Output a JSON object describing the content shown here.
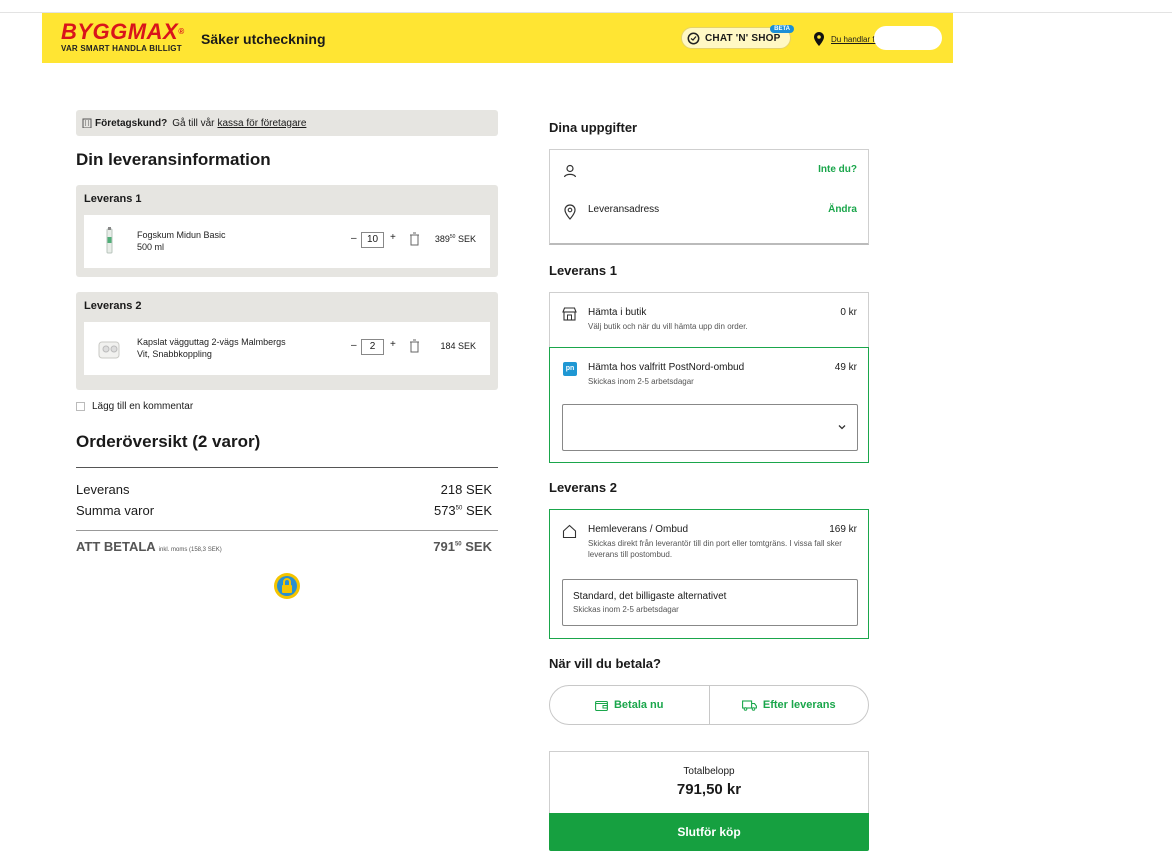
{
  "header": {
    "logo_text": "BYGGMAX",
    "logo_tagline": "VAR SMART HANDLA BILLIGT",
    "title": "Säker utcheckning",
    "chat_label": "CHAT 'N' SHOP",
    "chat_badge": "BETA",
    "store_link": "Du handlar frå"
  },
  "business": {
    "label": "Företagskund?",
    "text": "Gå till vår",
    "link": "kassa för företagare"
  },
  "delivery_info": {
    "title": "Din leveransinformation",
    "deliveries": [
      {
        "title": "Leverans 1",
        "product_name": "Fogskum Midun Basic",
        "product_detail": "500 ml",
        "quantity": "10",
        "price_main": "389",
        "price_dec": "50",
        "price_currency": "SEK"
      },
      {
        "title": "Leverans 2",
        "product_name": "Kapslat vägguttag 2-vägs Malmbergs",
        "product_detail": "Vit, Snabbkoppling",
        "quantity": "2",
        "price_main": "184",
        "price_dec": "",
        "price_currency": "SEK"
      }
    ],
    "comment_label": "Lägg till en kommentar"
  },
  "order_summary": {
    "title": "Orderöversikt (2 varor)",
    "shipping_label": "Leverans",
    "shipping_value": "218 SEK",
    "items_label": "Summa varor",
    "items_main": "573",
    "items_dec": "50",
    "items_currency": "SEK",
    "pay_label": "ATT BETALA",
    "pay_vat": "inkl. moms (158,3 SEK)",
    "pay_main": "791",
    "pay_dec": "50",
    "pay_currency": "SEK"
  },
  "details": {
    "title": "Dina uppgifter",
    "not_you": "Inte du?",
    "address_label": "Leveransadress",
    "change": "Ändra"
  },
  "shipping1": {
    "title": "Leverans 1",
    "opt1_title": "Hämta i butik",
    "opt1_sub": "Välj butik och när du vill hämta upp din order.",
    "opt1_price": "0 kr",
    "opt2_title": "Hämta hos valfritt PostNord-ombud",
    "opt2_sub": "Skickas inom 2-5 arbetsdagar",
    "opt2_price": "49 kr",
    "pn_badge": "pn"
  },
  "shipping2": {
    "title": "Leverans 2",
    "opt_title": "Hemleverans / Ombud",
    "opt_sub": "Skickas direkt från leverantör till din port eller tomtgräns. I vissa fall sker leverans till postombud.",
    "opt_price": "169 kr",
    "std_title": "Standard, det billigaste alternativet",
    "std_sub": "Skickas inom 2-5 arbetsdagar"
  },
  "payment": {
    "title": "När vill du betala?",
    "pay_now": "Betala nu",
    "pay_after": "Efter leverans"
  },
  "total": {
    "label": "Totalbelopp",
    "value": "791,50 kr",
    "checkout": "Slutför köp"
  },
  "colors": {
    "brand_yellow": "#ffe533",
    "brand_red": "#d9141b",
    "accent_green": "#1aa64b",
    "checkout_green": "#16a040"
  }
}
